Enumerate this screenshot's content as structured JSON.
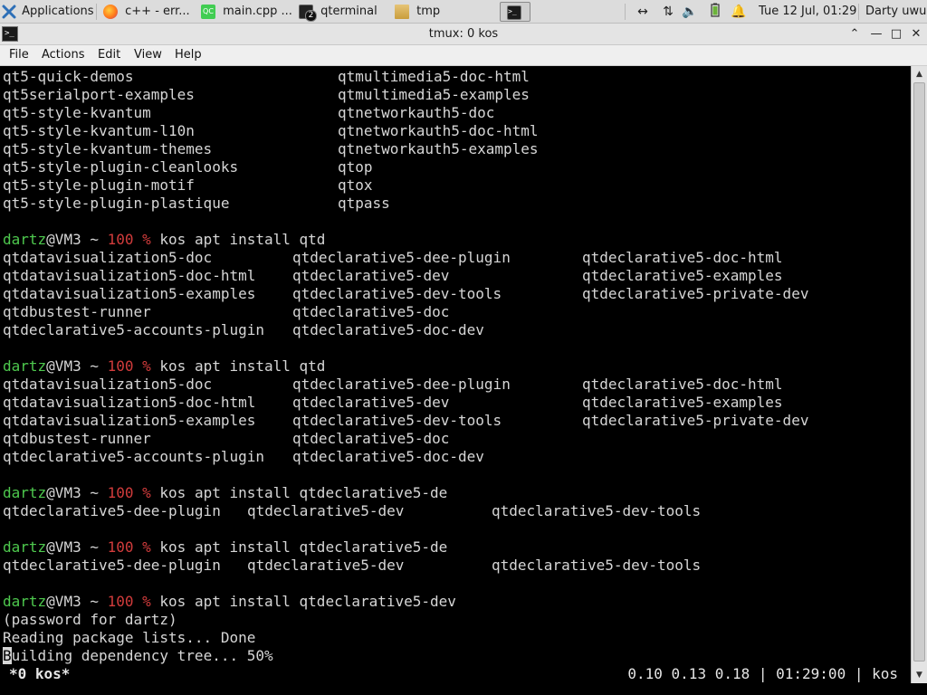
{
  "panel": {
    "apps_label": "Applications",
    "tasks": [
      {
        "label": "c++ - err...",
        "icon": "firefox-icon"
      },
      {
        "label": "main.cpp ...",
        "icon": "qtcreator-icon"
      },
      {
        "label": "qterminal",
        "icon": "terminal-icon",
        "badge": "2"
      },
      {
        "label": "tmp",
        "icon": "folder-icon"
      },
      {
        "label": "",
        "icon": "terminal-icon"
      }
    ],
    "clock": "Tue 12 Jul, 01:29",
    "user": "Darty uwu"
  },
  "window": {
    "title": "tmux: 0 kos"
  },
  "menu": [
    "File",
    "Actions",
    "Edit",
    "View",
    "Help"
  ],
  "terminal": {
    "listing_top": [
      [
        "qt5-quick-demos",
        "qtmultimedia5-doc-html"
      ],
      [
        "qt5serialport-examples",
        "qtmultimedia5-examples"
      ],
      [
        "qt5-style-kvantum",
        "qtnetworkauth5-doc"
      ],
      [
        "qt5-style-kvantum-l10n",
        "qtnetworkauth5-doc-html"
      ],
      [
        "qt5-style-kvantum-themes",
        "qtnetworkauth5-examples"
      ],
      [
        "qt5-style-plugin-cleanlooks",
        "qtop"
      ],
      [
        "qt5-style-plugin-motif",
        "qtox"
      ],
      [
        "qt5-style-plugin-plastique",
        "qtpass"
      ]
    ],
    "prompt_user": "dartz",
    "prompt_host": "@VM3 ~ ",
    "prompt_code": "100 %",
    "cmd1": " kos apt install qtd",
    "qtd_listing": [
      [
        "qtdatavisualization5-doc",
        "qtdeclarative5-dee-plugin",
        "qtdeclarative5-doc-html"
      ],
      [
        "qtdatavisualization5-doc-html",
        "qtdeclarative5-dev",
        "qtdeclarative5-examples"
      ],
      [
        "qtdatavisualization5-examples",
        "qtdeclarative5-dev-tools",
        "qtdeclarative5-private-dev"
      ],
      [
        "qtdbustest-runner",
        "qtdeclarative5-doc",
        ""
      ],
      [
        "qtdeclarative5-accounts-plugin",
        "qtdeclarative5-doc-dev",
        ""
      ]
    ],
    "cmd2": " kos apt install qtdeclarative5-de",
    "de_listing": [
      "qtdeclarative5-dee-plugin",
      "qtdeclarative5-dev",
      "qtdeclarative5-dev-tools"
    ],
    "cmd3": " kos apt install qtdeclarative5-dev",
    "out1": "(password for dartz)",
    "out2": "Reading package lists... Done",
    "out3_cursor": "B",
    "out3_rest": "uilding dependency tree... 50%",
    "status_left": "*0 kos*",
    "status_right": "0.10 0.13 0.18 | 01:29:00 | kos"
  },
  "colors": {
    "prompt_user": "#4ec94e",
    "prompt_code": "#d23c3c",
    "text": "#d6d6d6",
    "background": "#000000"
  }
}
